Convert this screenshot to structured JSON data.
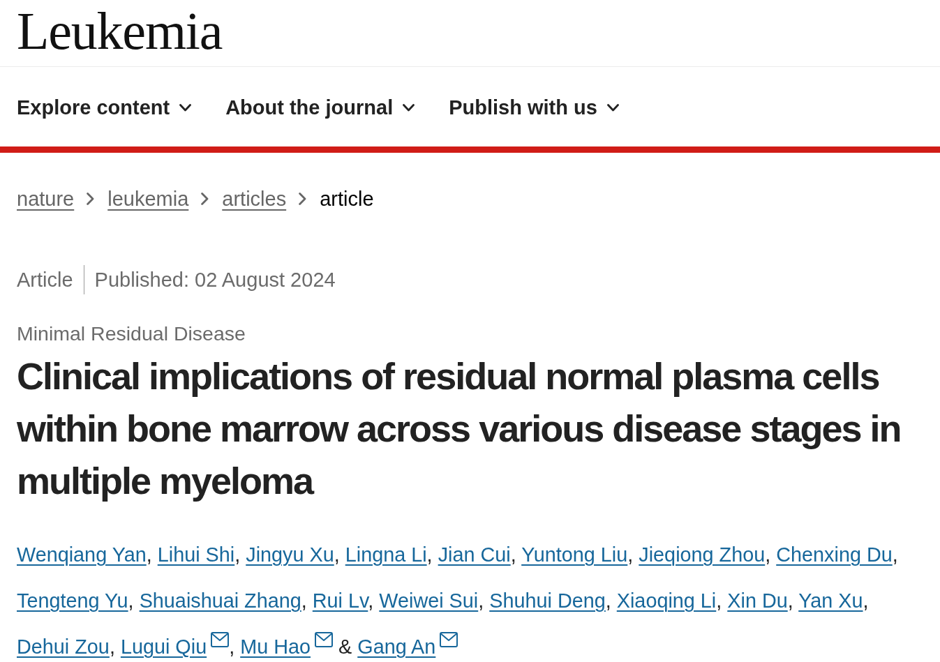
{
  "header": {
    "logo": "Leukemia"
  },
  "nav": {
    "items": [
      {
        "label": "Explore content"
      },
      {
        "label": "About the journal"
      },
      {
        "label": "Publish with us"
      }
    ]
  },
  "breadcrumbs": [
    {
      "label": "nature",
      "current": false
    },
    {
      "label": "leukemia",
      "current": false
    },
    {
      "label": "articles",
      "current": false
    },
    {
      "label": "article",
      "current": true
    }
  ],
  "article_meta": {
    "type": "Article",
    "published": "Published: 02 August 2024"
  },
  "subject": "Minimal Residual Disease",
  "title": "Clinical implications of residual normal plasma cells within bone marrow across various disease stages in multiple myeloma",
  "authors": [
    {
      "name": "Wenqiang Yan",
      "corresponding": false,
      "separator": ", "
    },
    {
      "name": "Lihui Shi",
      "corresponding": false,
      "separator": ", "
    },
    {
      "name": "Jingyu Xu",
      "corresponding": false,
      "separator": ", "
    },
    {
      "name": "Lingna Li",
      "corresponding": false,
      "separator": ", "
    },
    {
      "name": "Jian Cui",
      "corresponding": false,
      "separator": ", "
    },
    {
      "name": "Yuntong Liu",
      "corresponding": false,
      "separator": ", "
    },
    {
      "name": "Jieqiong Zhou",
      "corresponding": false,
      "separator": ", "
    },
    {
      "name": "Chenxing Du",
      "corresponding": false,
      "separator": ", "
    },
    {
      "name": "Tengteng Yu",
      "corresponding": false,
      "separator": ", "
    },
    {
      "name": "Shuaishuai Zhang",
      "corresponding": false,
      "separator": ", "
    },
    {
      "name": "Rui Lv",
      "corresponding": false,
      "separator": ", "
    },
    {
      "name": "Weiwei Sui",
      "corresponding": false,
      "separator": ", "
    },
    {
      "name": "Shuhui Deng",
      "corresponding": false,
      "separator": ", "
    },
    {
      "name": "Xiaoqing Li",
      "corresponding": false,
      "separator": ", "
    },
    {
      "name": "Xin Du",
      "corresponding": false,
      "separator": ", "
    },
    {
      "name": "Yan Xu",
      "corresponding": false,
      "separator": ", "
    },
    {
      "name": "Dehui Zou",
      "corresponding": false,
      "separator": ", "
    },
    {
      "name": "Lugui Qiu",
      "corresponding": true,
      "separator": ", "
    },
    {
      "name": "Mu Hao",
      "corresponding": true,
      "separator": " & "
    },
    {
      "name": "Gang An",
      "corresponding": true
    }
  ]
}
